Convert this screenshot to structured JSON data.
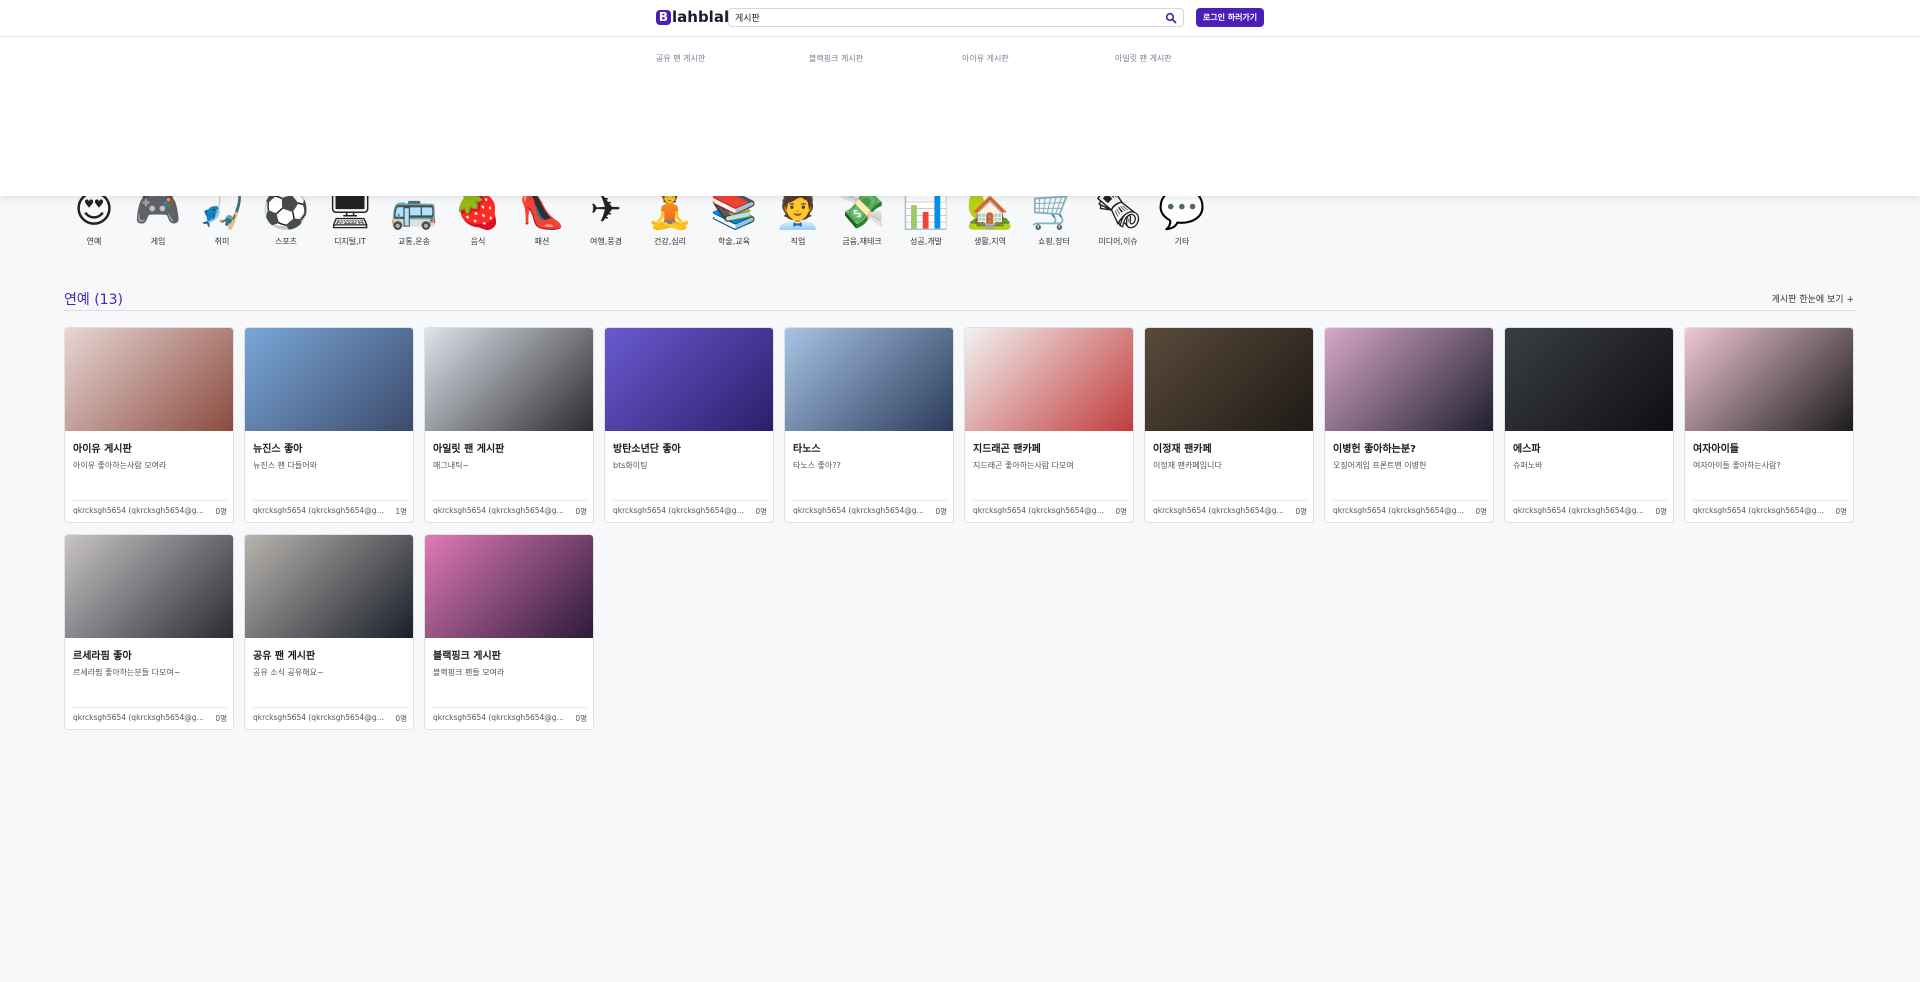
{
  "header": {
    "logo_initial": "B",
    "logo_rest": "lahblah",
    "search_value": "게시판",
    "login_label": "로그인 하러가기"
  },
  "suggestions": [
    "공유 팬 게시판",
    "블랙핑크 게시판",
    "아이유 게시판",
    "아일릿 팬 게시판"
  ],
  "categories": [
    {
      "label": "연예",
      "emoji": "😍"
    },
    {
      "label": "게임",
      "emoji": "🎮"
    },
    {
      "label": "취미",
      "emoji": "🎣"
    },
    {
      "label": "스포츠",
      "emoji": "⚽"
    },
    {
      "label": "디지털,IT",
      "emoji": "🖥"
    },
    {
      "label": "교통,운송",
      "emoji": "🚌"
    },
    {
      "label": "음식",
      "emoji": "🍓"
    },
    {
      "label": "패션",
      "emoji": "👠"
    },
    {
      "label": "여행,풍경",
      "emoji": "✈"
    },
    {
      "label": "건강,심리",
      "emoji": "🧘"
    },
    {
      "label": "학술,교육",
      "emoji": "📚"
    },
    {
      "label": "직업",
      "emoji": "🧑‍💼"
    },
    {
      "label": "금융,재테크",
      "emoji": "💸"
    },
    {
      "label": "성공,개발",
      "emoji": "📊"
    },
    {
      "label": "생활,지역",
      "emoji": "🏡"
    },
    {
      "label": "쇼핑,장터",
      "emoji": "🛒"
    },
    {
      "label": "미디어,이슈",
      "emoji": "🗞"
    },
    {
      "label": "기타",
      "emoji": "💬"
    }
  ],
  "section": {
    "title": "연예 (13)",
    "more_label": "게시판 한눈에 보기 +"
  },
  "boards": [
    {
      "title": "아이유 게시판",
      "desc": "아이유 좋아하는사람 모여라",
      "author": "qkrcksgh5654 (qkrcksgh5654@gmai...",
      "count": "0명",
      "colors": [
        "#e8d6d4",
        "#8a4a3e"
      ]
    },
    {
      "title": "뉴진스 좋아",
      "desc": "뉴진스 팬 다들어와",
      "author": "qkrcksgh5654 (qkrcksgh5654@gmail...",
      "count": "1명",
      "colors": [
        "#7aa6d8",
        "#3a4a6a"
      ]
    },
    {
      "title": "아일릿 팬 게시판",
      "desc": "매그내틱~",
      "author": "qkrcksgh5654 (qkrcksgh5654@gmai...",
      "count": "0명",
      "colors": [
        "#dfe4ea",
        "#2a2a30"
      ]
    },
    {
      "title": "방탄소년단 좋아",
      "desc": "bts화이팅",
      "author": "qkrcksgh5654 (qkrcksgh5654@gmai...",
      "count": "0명",
      "colors": [
        "#6a5ad0",
        "#2a1e6a"
      ]
    },
    {
      "title": "타노스",
      "desc": "타노스 좋아??",
      "author": "qkrcksgh5654 (qkrcksgh5654@gmai...",
      "count": "0명",
      "colors": [
        "#a8c4e4",
        "#2a3a5a"
      ]
    },
    {
      "title": "지드래곤 팬카페",
      "desc": "지드래곤 좋아하는사람 다모여",
      "author": "qkrcksgh5654 (qkrcksgh5654@gmai...",
      "count": "0명",
      "colors": [
        "#f2f2f2",
        "#c23a3a"
      ]
    },
    {
      "title": "이정재 팬카페",
      "desc": "이정재 팬카페입니다",
      "author": "qkrcksgh5654 (qkrcksgh5654@gmai...",
      "count": "0명",
      "colors": [
        "#5a4a3a",
        "#1e1a16"
      ]
    },
    {
      "title": "이병헌 좋아하는분?",
      "desc": "오징어게임 프론트맨 이병헌",
      "author": "qkrcksgh5654 (qkrcksgh5654@gmai...",
      "count": "0명",
      "colors": [
        "#d8a8c8",
        "#1e1e2e"
      ]
    },
    {
      "title": "에스파",
      "desc": "슈퍼노바",
      "author": "qkrcksgh5654 (qkrcksgh5654@gmai...",
      "count": "0명",
      "colors": [
        "#3a3e44",
        "#0e0e12"
      ]
    },
    {
      "title": "여자아이들",
      "desc": "여자아이들 좋아하는사람?",
      "author": "qkrcksgh5654 (qkrcksgh5654@gmai...",
      "count": "0명",
      "colors": [
        "#f0c8d4",
        "#1a1a1a"
      ]
    },
    {
      "title": "르세라핌 좋아",
      "desc": "르세라핌 좋아하는분들 다모여~",
      "author": "qkrcksgh5654 (qkrcksgh5654@gmai...",
      "count": "0명",
      "colors": [
        "#c8c4c8",
        "#2a2a2e"
      ]
    },
    {
      "title": "공유 팬 게시판",
      "desc": "공유 소식 공유해요~",
      "author": "qkrcksgh5654 (qkrcksgh5654@gmai...",
      "count": "0명",
      "colors": [
        "#b8b4ae",
        "#1a1e2a"
      ]
    },
    {
      "title": "블랙핑크 게시판",
      "desc": "블랙핑크 팬들 모여라",
      "author": "qkrcksgh5654 (qkrcksgh5654@gmai...",
      "count": "0명",
      "colors": [
        "#e07ab4",
        "#2a1a3a"
      ]
    }
  ]
}
